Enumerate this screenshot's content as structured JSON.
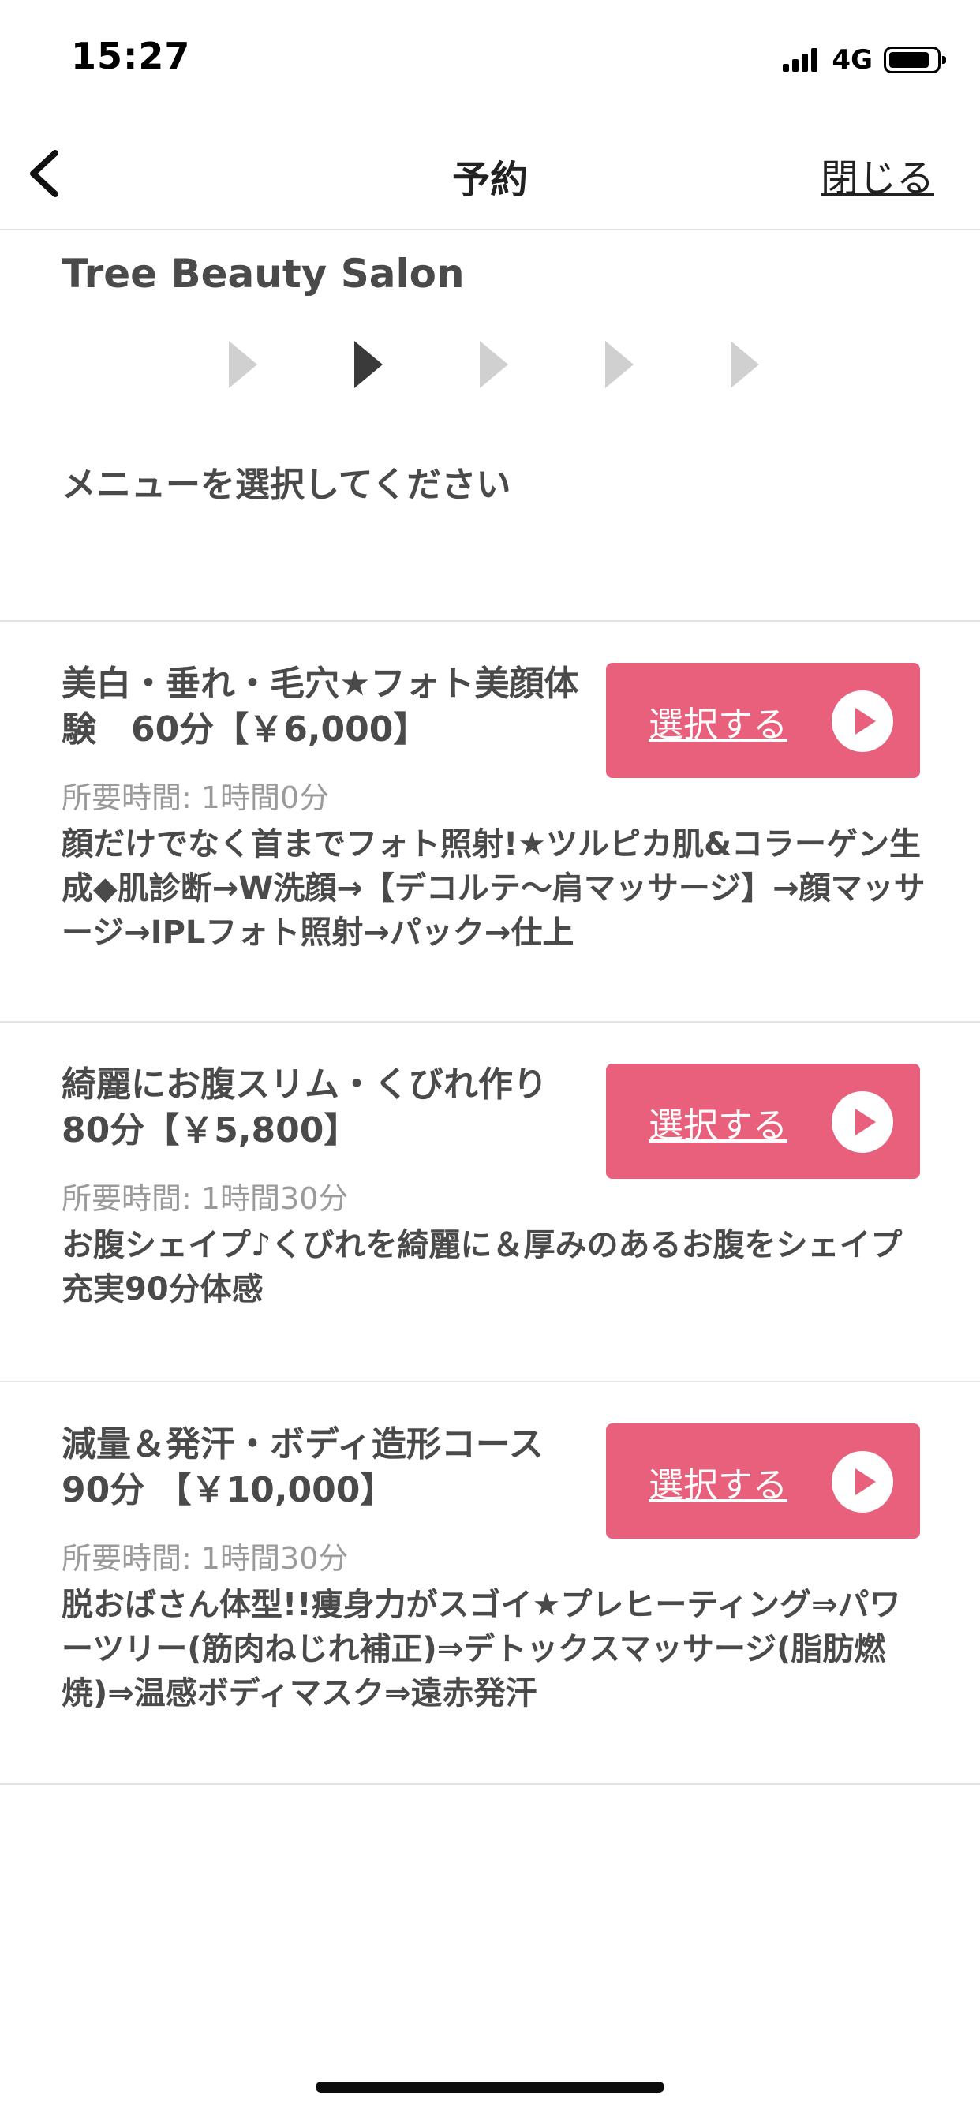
{
  "status_bar": {
    "time": "15:27",
    "network": "4G"
  },
  "nav": {
    "title": "予約",
    "close_label": "閉じる"
  },
  "salon": {
    "name": "Tree Beauty Salon"
  },
  "steps": {
    "count": 5,
    "active_index": 1
  },
  "instruction": "メニューを選択してください",
  "menu_items": [
    {
      "title": "美白・垂れ・毛穴★フォト美顔体験　60分【￥6,000】",
      "duration": "所要時間: 1時間0分",
      "description": "顔だけでなく首までフォト照射!★ツルピカ肌&コラーゲン生成◆肌診断→W洗顔→【デコルテ〜肩マッサージ】→顔マッサージ→IPLフォト照射→パック→仕上",
      "button_label": "選択する"
    },
    {
      "title": "綺麗にお腹スリム・くびれ作り　80分【￥5,800】",
      "duration": "所要時間: 1時間30分",
      "description": "お腹シェイプ♪くびれを綺麗に＆厚みのあるお腹をシェイプ　充実90分体感",
      "button_label": "選択する"
    },
    {
      "title": "減量＆発汗・ボディ造形コース　90分 【￥10,000】",
      "duration": "所要時間: 1時間30分",
      "description": "脱おばさん体型!!痩身力がスゴイ★プレヒーティング⇒パワーツリー(筋肉ねじれ補正)⇒デトックスマッサージ(脂肪燃焼)⇒温感ボディマスク⇒遠赤発汗",
      "button_label": "選択する"
    }
  ],
  "colors": {
    "accent": "#e8607b",
    "step_inactive": "#d0d0d0",
    "step_active": "#3a3a3a"
  }
}
